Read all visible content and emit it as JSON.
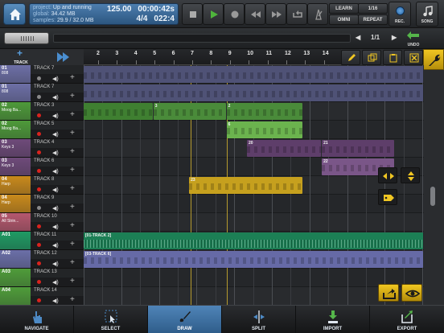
{
  "topbar": {
    "info": {
      "project_label": "project:",
      "project": "Up and running",
      "global_label": "global:",
      "global": "34.42 MB",
      "samples_label": "samples:",
      "samples": "29.9 / 32.0 MB",
      "tempo": "125.00",
      "time": "00:00:42s",
      "signature": "4/4",
      "position": "022:4"
    },
    "learn_label": "LEARN",
    "omni_label": "OMNI",
    "quantize_label": "1/16",
    "repeat_label": "REPEAT",
    "rec_label": "REC.",
    "song_label": "SONG"
  },
  "bar2": {
    "page": "1/1",
    "undo_label": "UNDO"
  },
  "ruler": {
    "add_track_label": "TRACK",
    "ticks": [
      "2",
      "3",
      "4",
      "5",
      "6",
      "7",
      "8",
      "9",
      "10",
      "11",
      "12",
      "13",
      "14"
    ]
  },
  "tracks": [
    {
      "num": "01",
      "sub": "808",
      "name": "TRACK 7",
      "color": "#6d6fa6",
      "rec": false
    },
    {
      "num": "01",
      "sub": "808",
      "name": "TRACK 7",
      "color": "#6d6fa6",
      "rec": false
    },
    {
      "num": "02",
      "sub": "Moog Ba...",
      "name": "TRACK 3",
      "color": "#4e9a3a",
      "rec": true
    },
    {
      "num": "02",
      "sub": "Moog Ba...",
      "name": "TRACK 5",
      "color": "#4e9a3a",
      "rec": true
    },
    {
      "num": "03",
      "sub": "Keys 3",
      "name": "TRACK 4",
      "color": "#6e4a7a",
      "rec": true
    },
    {
      "num": "03",
      "sub": "Keys 3",
      "name": "TRACK 6",
      "color": "#6e4a7a",
      "rec": true
    },
    {
      "num": "04",
      "sub": "Harp",
      "name": "TRACK 8",
      "color": "#c98a1c",
      "rec": true
    },
    {
      "num": "04",
      "sub": "Harp",
      "name": "TRACK 9",
      "color": "#c98a1c",
      "rec": false
    },
    {
      "num": "05",
      "sub": "All Strin...",
      "name": "TRACK 10",
      "color": "#b5586e",
      "rec": true
    },
    {
      "num": "A01",
      "sub": "",
      "name": "TRACK 11",
      "color": "#1f9b64",
      "rec": true
    },
    {
      "num": "A02",
      "sub": "",
      "name": "TRACK 12",
      "color": "#6b6fa8",
      "rec": true
    },
    {
      "num": "A03",
      "sub": "",
      "name": "TRACK 13",
      "color": "#4f9c3a",
      "rec": true
    },
    {
      "num": "A04",
      "sub": "",
      "name": "TRACK 14",
      "color": "#4f9c3a",
      "rec": true
    }
  ],
  "clips": [
    {
      "lane": 0,
      "start": 0.0,
      "end": 1.0,
      "color": "#4f5276",
      "label": ""
    },
    {
      "lane": 1,
      "start": 0.0,
      "end": 1.0,
      "color": "#4f5276",
      "label": ""
    },
    {
      "lane": 2,
      "start": 0.0,
      "end": 0.205,
      "color": "#3f7f31",
      "label": ""
    },
    {
      "lane": 2,
      "start": 0.205,
      "end": 0.42,
      "color": "#4a8b3a",
      "label": "3"
    },
    {
      "lane": 2,
      "start": 0.42,
      "end": 0.645,
      "color": "#4a8b3a",
      "label": "2"
    },
    {
      "lane": 3,
      "start": 0.42,
      "end": 0.645,
      "color": "#6bb34e",
      "label": "6"
    },
    {
      "lane": 4,
      "start": 0.48,
      "end": 0.7,
      "color": "#5e3e6a",
      "label": "20"
    },
    {
      "lane": 4,
      "start": 0.7,
      "end": 0.915,
      "color": "#5e3e6a",
      "label": "21"
    },
    {
      "lane": 5,
      "start": 0.7,
      "end": 0.915,
      "color": "#7a5688",
      "label": "22"
    },
    {
      "lane": 6,
      "start": 0.31,
      "end": 0.645,
      "color": "#c6a01e",
      "label": "23"
    },
    {
      "lane": 9,
      "start": 0.0,
      "end": 1.0,
      "color": "#1c7f55",
      "label": "[01-TRACK 2]",
      "audio": true
    },
    {
      "lane": 10,
      "start": 0.0,
      "end": 1.0,
      "color": "#666aa6",
      "label": "[03-TRACK 6]"
    }
  ],
  "bottombar": {
    "navigate": "NAVIGATE",
    "select": "SELECT",
    "draw": "DRAW",
    "split": "SPLIT",
    "import": "IMPORT",
    "export": "EXPORT"
  }
}
